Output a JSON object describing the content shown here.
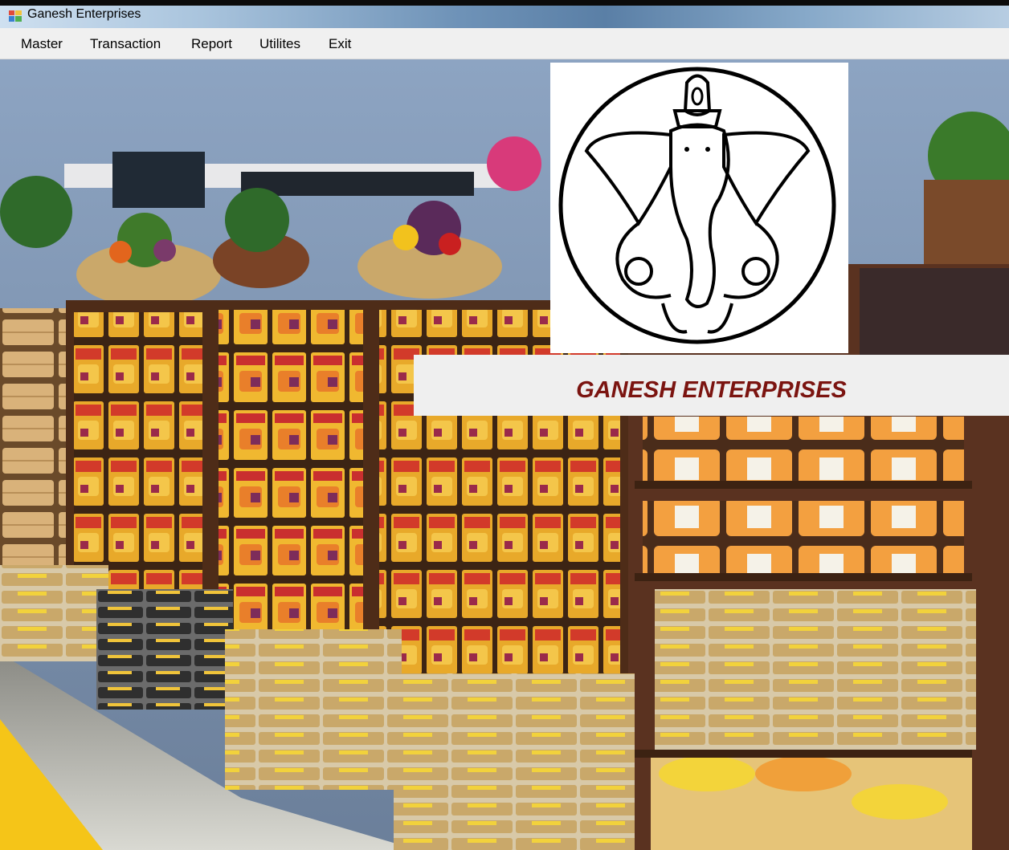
{
  "window": {
    "title": "Ganesh Enterprises",
    "app_icon": "window-app-icon"
  },
  "menu": [
    {
      "label": "Master"
    },
    {
      "label": "Transaction"
    },
    {
      "label": "Report"
    },
    {
      "label": "Utilites"
    },
    {
      "label": "Exit"
    }
  ],
  "banner": {
    "company_name": "GANESH ENTERPRISES"
  },
  "background": {
    "description_icon": "store-shelves-photo"
  },
  "logo": {
    "icon": "ganesha-logo-icon"
  },
  "colors": {
    "brand_text": "#7b1410",
    "menu_bg": "#f0f0f0",
    "shelf_wood": "#5a3220"
  }
}
